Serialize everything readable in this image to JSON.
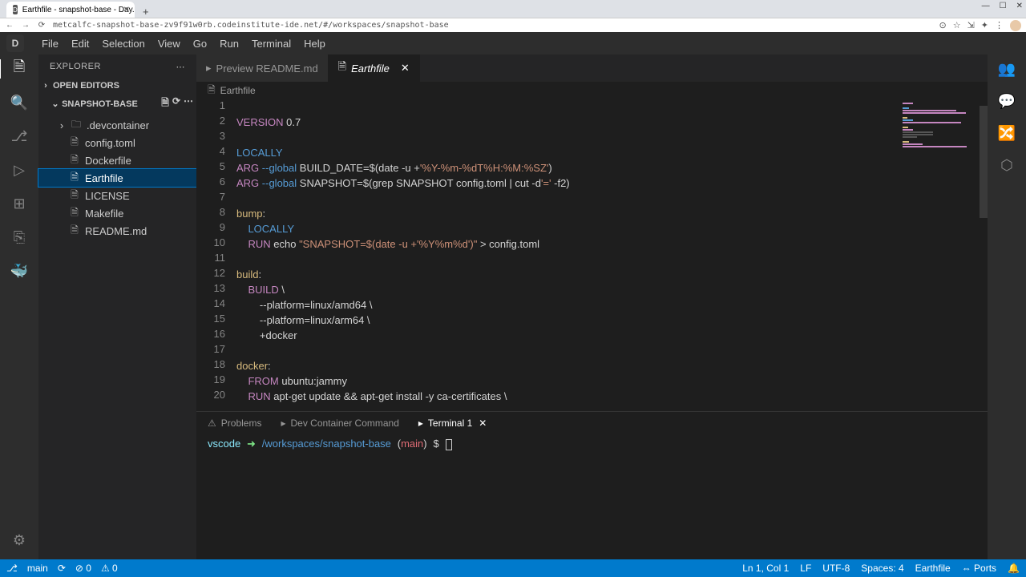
{
  "browser": {
    "tab_title": "Earthfile - snapshot-base - Day...",
    "favicon": "D",
    "url": "metcalfc-snapshot-base-zv9f91w0rb.codeinstitute-ide.net/#/workspaces/snapshot-base"
  },
  "menu": {
    "items": [
      "File",
      "Edit",
      "Selection",
      "View",
      "Go",
      "Run",
      "Terminal",
      "Help"
    ],
    "logo": "D"
  },
  "activity_right": [
    "👥",
    "💬",
    "🔀",
    "⬡"
  ],
  "sidebar": {
    "title": "EXPLORER",
    "open_editors": "OPEN EDITORS",
    "project": "SNAPSHOT-BASE",
    "folder": ".devcontainer",
    "files": [
      "config.toml",
      "Dockerfile",
      "Earthfile",
      "LICENSE",
      "Makefile",
      "README.md"
    ],
    "selected": 2
  },
  "tabs": [
    {
      "icon": "▸",
      "label": "Preview README.md",
      "active": false,
      "closable": false
    },
    {
      "icon": "🗎",
      "label": "Earthfile",
      "active": true,
      "closable": true
    }
  ],
  "breadcrumb": {
    "icon": "🗎",
    "text": "Earthfile"
  },
  "code": [
    {
      "n": 1,
      "html": ""
    },
    {
      "n": 2,
      "html": "<span class='k1'>VERSION</span> <span class='op'>0.7</span>"
    },
    {
      "n": 3,
      "html": ""
    },
    {
      "n": 4,
      "html": "<span class='k2'>LOCALLY</span>"
    },
    {
      "n": 5,
      "html": "<span class='k1'>ARG</span> <span class='k2'>--global</span> <span class='op'>BUILD_DATE=$(</span><span class='op'>date -u +</span><span class='s1'>'%Y-%m-%dT%H:%M:%SZ'</span><span class='op'>)</span>"
    },
    {
      "n": 6,
      "html": "<span class='k1'>ARG</span> <span class='k2'>--global</span> <span class='op'>SNAPSHOT=$(grep SNAPSHOT config.toml | cut -d</span><span class='s1'>'='</span> <span class='op'>-f2)</span>"
    },
    {
      "n": 7,
      "html": ""
    },
    {
      "n": 8,
      "html": "<span class='tgt'>bump</span><span class='op'>:</span>"
    },
    {
      "n": 9,
      "html": "    <span class='k2'>LOCALLY</span>"
    },
    {
      "n": 10,
      "html": "    <span class='k1'>RUN</span> <span class='op'>echo </span><span class='s1'>\"SNAPSHOT=$(date -u +'%Y%m%d')\"</span> <span class='op'>&gt; config.toml</span>"
    },
    {
      "n": 11,
      "html": ""
    },
    {
      "n": 12,
      "html": "<span class='tgt'>build</span><span class='op'>:</span>"
    },
    {
      "n": 13,
      "html": "    <span class='k1'>BUILD</span> <span class='op'>\\</span>"
    },
    {
      "n": 14,
      "html": "        <span class='op'>--platform=linux/amd64 \\</span>"
    },
    {
      "n": 15,
      "html": "        <span class='op'>--platform=linux/arm64 \\</span>"
    },
    {
      "n": 16,
      "html": "        <span class='op'>+docker</span>"
    },
    {
      "n": 17,
      "html": ""
    },
    {
      "n": 18,
      "html": "<span class='tgt'>docker</span><span class='op'>:</span>"
    },
    {
      "n": 19,
      "html": "    <span class='k1'>FROM</span> <span class='op'>ubuntu:jammy</span>"
    },
    {
      "n": 20,
      "html": "    <span class='k1'>RUN</span> <span class='op'>apt-get update &amp;&amp; apt-get install -y ca-certificates \\</span>"
    }
  ],
  "panel": {
    "tabs": [
      {
        "icon": "⚠",
        "label": "Problems",
        "active": false
      },
      {
        "icon": "▸",
        "label": "Dev Container Command",
        "active": false
      },
      {
        "icon": "▸",
        "label": "Terminal 1",
        "active": true,
        "closable": true
      }
    ],
    "prompt": {
      "user": "vscode",
      "arrow": "➜",
      "path": "/workspaces/snapshot-base",
      "branch": "main",
      "sym": "$"
    }
  },
  "gitbar": {
    "branch": "main",
    "sync": "⟳",
    "errs": "⊘ 0",
    "warns": "⚠ 0"
  },
  "status": {
    "left": "⚡",
    "right": [
      "Ln 1, Col 1",
      "LF",
      "UTF-8",
      "Spaces: 4",
      "Earthfile",
      "⇔ Ports",
      "🔔"
    ]
  }
}
